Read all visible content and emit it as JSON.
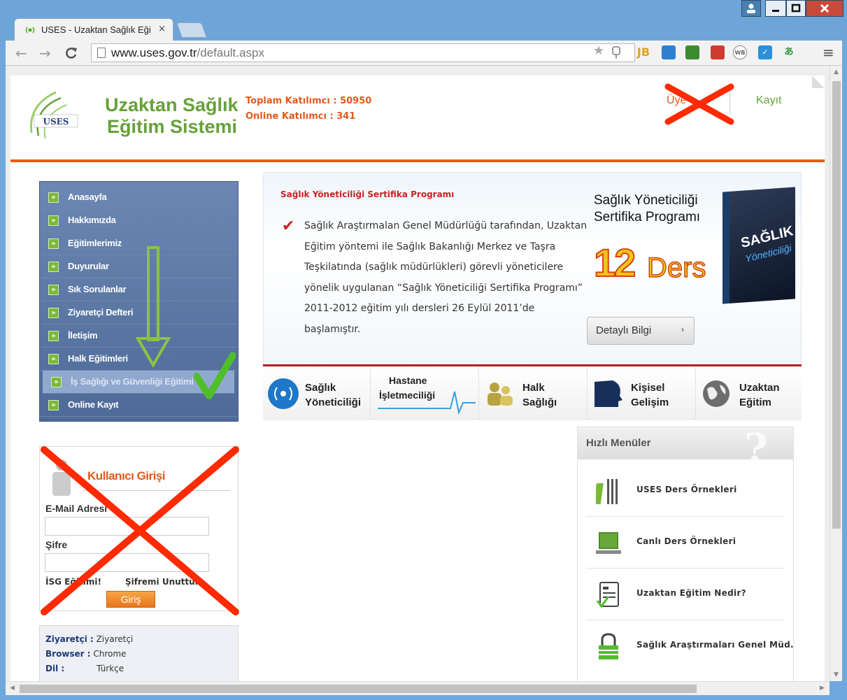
{
  "browser": {
    "tab_title": "USES - Uzaktan Sağlık Eği",
    "tab_close": "×",
    "url_host": "www.uses.gov.tr",
    "url_path": "/default.aspx",
    "ext_jb": "JB",
    "ext_wb": "WB"
  },
  "header": {
    "logo_text": "USES",
    "logo_line1": "Uzaktan Sağlık",
    "logo_line2": "Eğitim Sistemi",
    "total_label": "Toplam Katılımcı : 50950",
    "online_label": "Online Katılımcı : 341",
    "uye_link": "Üye",
    "kayit_link": "Kayıt"
  },
  "nav": [
    {
      "label": "Anasayfa"
    },
    {
      "label": "Hakkımızda"
    },
    {
      "label": "Eğitimlerimiz"
    },
    {
      "label": "Duyurular"
    },
    {
      "label": "Sık Sorulanlar"
    },
    {
      "label": "Ziyaretçi Defteri"
    },
    {
      "label": "İletişim"
    },
    {
      "label": "Halk Eğitimleri"
    },
    {
      "label": "İş Sağlığı ve Güvenliği Eğitimi"
    },
    {
      "label": "Online Kayıt"
    }
  ],
  "login": {
    "title": "Kullanıcı Girişi",
    "email_label": "E-Mail Adresi",
    "password_label": "Şifre",
    "isg_link": "İSG Eğitimi!",
    "forgot_link": "Şifremi Unuttum",
    "submit": "Giriş"
  },
  "visitor": {
    "visitor_key": "Ziyaretçi :",
    "visitor_val": "Ziyaretçi",
    "browser_key": "Browser :",
    "browser_val": "Chrome",
    "lang_key": "Dil :",
    "lang_val": "Türkçe"
  },
  "banner": {
    "title": "Sağlık Yöneticiliği Sertifika Programı",
    "text": "Sağlık Araştırmalan Genel Müdürlüğü tarafından, Uzaktan Eğitim yöntemi ile Sağlık Bakanlığı Merkez ve Taşra Teşkilatında (sağlık müdürlükleri) görevli yöneticilere yönelik uygulanan “Sağlık Yöneticiliği Sertifika Programı” 2011-2012 eğitim yılı dersleri 26 Eylül 2011’de başlamıştır.",
    "promo_title": "Sağlık Yöneticiliği Sertifika Programı",
    "promo_number": "12",
    "promo_ders": "Ders",
    "box_line1": "SAĞLIK",
    "box_line2": "Yöneticiliği",
    "detail_button": "Detaylı Bilgi",
    "detail_chevron": "›"
  },
  "categories": [
    {
      "line1": "Sağlık",
      "line2": "Yöneticiliği"
    },
    {
      "line1": "Hastane",
      "line2": "İşletmeciliği"
    },
    {
      "line1": "Halk",
      "line2": "Sağlığı"
    },
    {
      "line1": "Kişisel",
      "line2": "Gelişim"
    },
    {
      "line1": "Uzaktan",
      "line2": "Eğitim"
    }
  ],
  "quick_menu": {
    "title": "Hızlı Menüler",
    "items": [
      {
        "label": "USES Ders Örnekleri"
      },
      {
        "label": "Canlı Ders Örnekleri"
      },
      {
        "label": "Uzaktan Eğitim Nedir?"
      },
      {
        "label": "Sağlık Araştırmaları Genel Müd."
      }
    ]
  },
  "colors": {
    "accent_orange": "#ef5a17",
    "brand_green": "#67a13a",
    "nav_blue": "#5a76a6",
    "banner_red": "#b51e1e"
  }
}
